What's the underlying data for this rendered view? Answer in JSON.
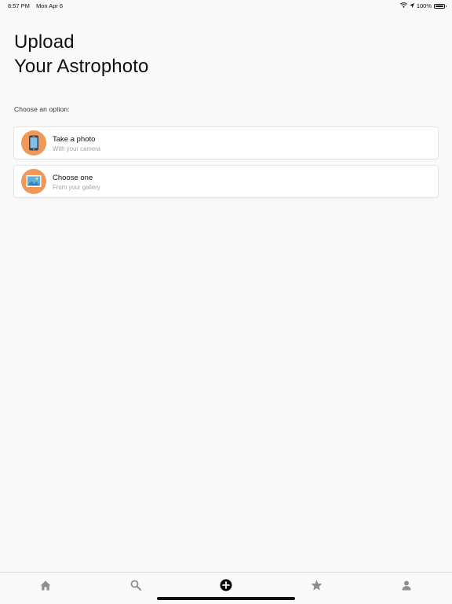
{
  "status_bar": {
    "time": "8:57 PM",
    "date": "Mon Apr 6",
    "battery": "100%",
    "icons": [
      "wifi-icon",
      "location-arrow-icon",
      "battery-icon"
    ]
  },
  "header": {
    "title_line1": "Upload",
    "title_line2": "Your Astrophoto"
  },
  "prompt": "Choose an option:",
  "options": [
    {
      "title": "Take a photo",
      "subtitle": "With your camera",
      "icon": "phone-icon"
    },
    {
      "title": "Choose one",
      "subtitle": "From your gallery",
      "icon": "image-icon"
    }
  ],
  "tab_bar": {
    "tabs": [
      "home-icon",
      "search-icon",
      "add-icon",
      "star-icon",
      "profile-icon"
    ],
    "active": "add-icon"
  },
  "colors": {
    "accent": "#f0975a",
    "icon_inactive": "#8e8e93",
    "icon_active": "#000000",
    "background": "#f9f9f9"
  }
}
